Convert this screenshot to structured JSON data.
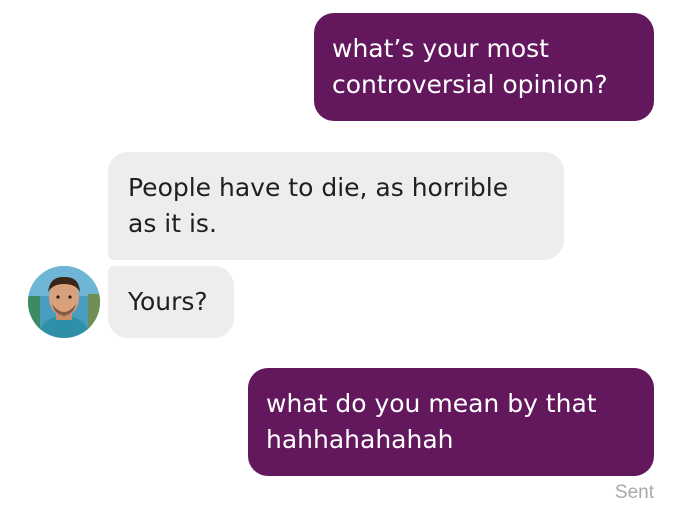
{
  "conversation": {
    "messages": [
      {
        "sender": "me",
        "lines": [
          "what’s your most",
          "controversial opinion?"
        ]
      },
      {
        "sender": "them",
        "lines": [
          "People have to die, as horrible",
          "as it is."
        ]
      },
      {
        "sender": "them",
        "lines": [
          "Yours?"
        ]
      },
      {
        "sender": "me",
        "lines": [
          "what do you mean by that",
          "hahhahahahah"
        ]
      }
    ],
    "delivery_status": "Sent",
    "avatar_icon": "person-avatar",
    "colors": {
      "sent_bubble": "#63185e",
      "received_bubble": "#ededee",
      "status_text": "#a9a9ad"
    }
  }
}
